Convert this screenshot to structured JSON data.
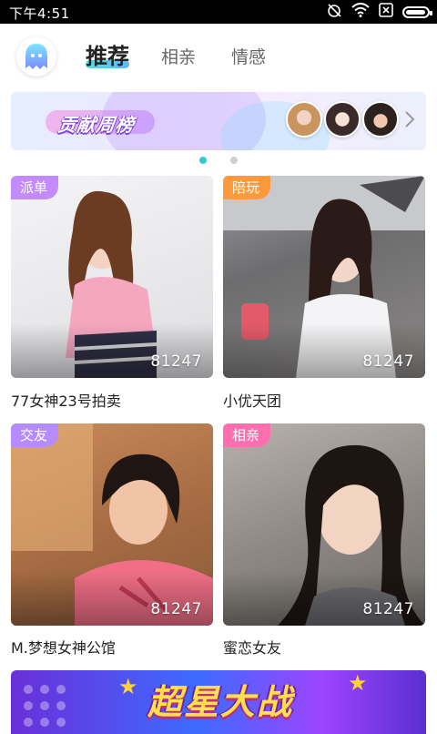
{
  "status_bar": {
    "time": "下午4:51",
    "icons": [
      "alarm-off-icon",
      "wifi-icon",
      "sim-x-icon",
      "battery-icon"
    ],
    "battery_level": 0.95
  },
  "header": {
    "tabs": [
      {
        "label": "推荐",
        "active": true
      },
      {
        "label": "相亲",
        "active": false
      },
      {
        "label": "情感",
        "active": false
      }
    ]
  },
  "weekly_banner": {
    "title": "贡献周榜"
  },
  "carousel": {
    "pages": 2,
    "active_index": 0,
    "active_color": "#38c6dc",
    "inactive_color": "#d0d0d0"
  },
  "rooms": [
    {
      "tag": "派单",
      "tag_color": "#c48bff",
      "count": "81247",
      "title": "77女神23号拍卖"
    },
    {
      "tag": "陪玩",
      "tag_color": "#ff9a3c",
      "count": "81247",
      "title": "小优天团"
    },
    {
      "tag": "交友",
      "tag_color": "#b68bff",
      "count": "81247",
      "title": "M.梦想女神公馆"
    },
    {
      "tag": "相亲",
      "tag_color": "#ff6fb0",
      "count": "81247",
      "title": "蜜恋女友"
    }
  ],
  "bottom_banner": {
    "title": "超星大战"
  }
}
